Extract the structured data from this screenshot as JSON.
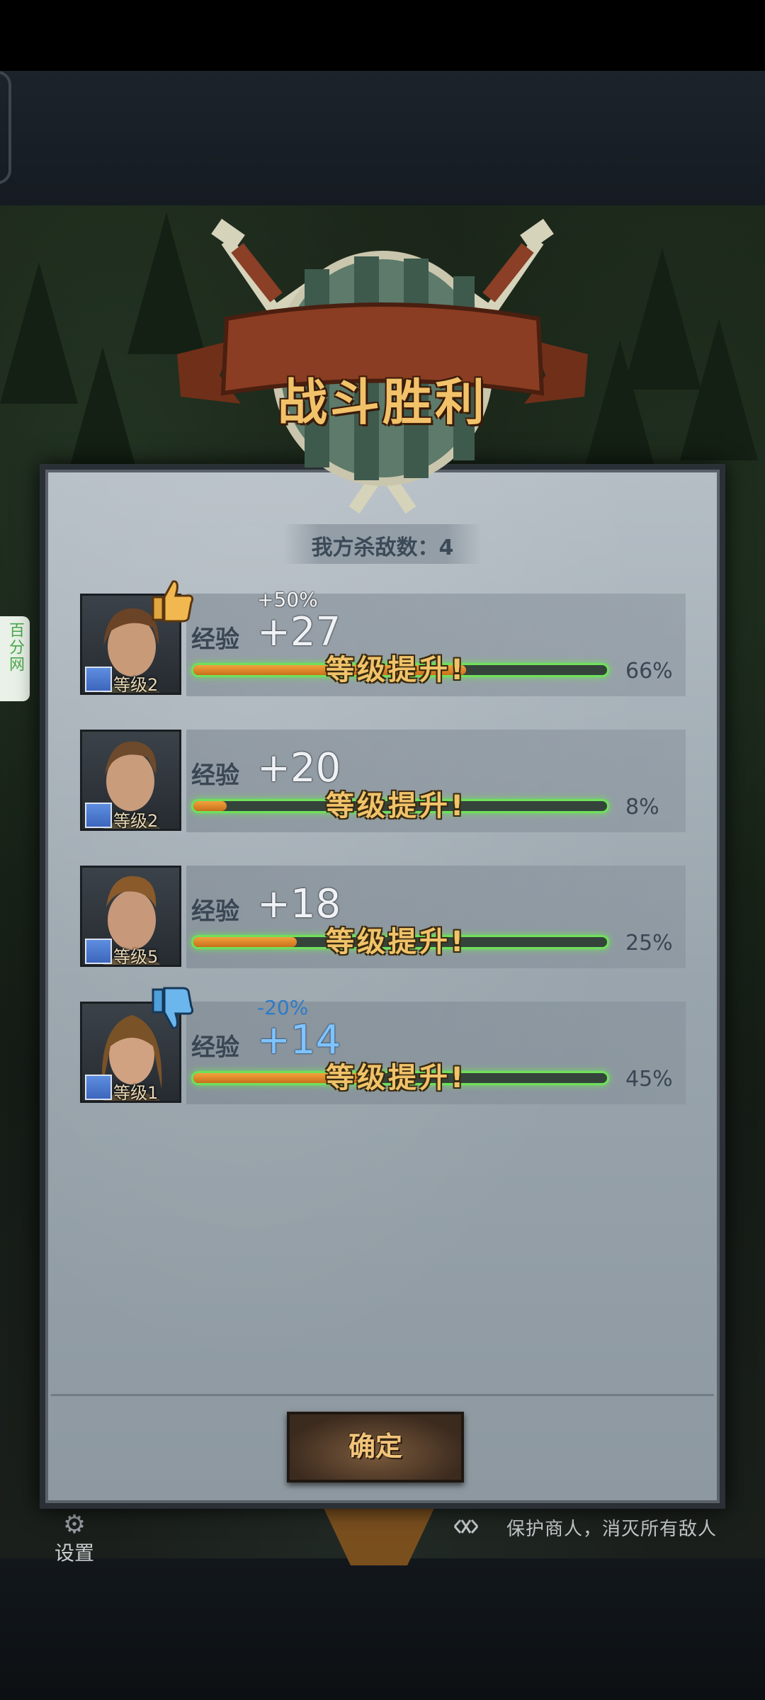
{
  "title": "战斗胜利",
  "kills": "我方杀敌数：4",
  "side_badge": "百分网",
  "heroes": [
    {
      "exp_label": "经验",
      "exp_gain": "+27",
      "bonus": "+50%",
      "bonus_kind": "positive",
      "level": "等级2",
      "level_up": "等级提升!",
      "progress_pct": 66,
      "progress_text": "66%",
      "thumb": "thumbs-up"
    },
    {
      "exp_label": "经验",
      "exp_gain": "+20",
      "bonus": "",
      "bonus_kind": "none",
      "level": "等级2",
      "level_up": "等级提升!",
      "progress_pct": 8,
      "progress_text": "8%",
      "thumb": "none"
    },
    {
      "exp_label": "经验",
      "exp_gain": "+18",
      "bonus": "",
      "bonus_kind": "none",
      "level": "等级5",
      "level_up": "等级提升!",
      "progress_pct": 25,
      "progress_text": "25%",
      "thumb": "none"
    },
    {
      "exp_label": "经验",
      "exp_gain": "+14",
      "bonus": "-20%",
      "bonus_kind": "negative",
      "level": "等级1",
      "level_up": "等级提升!",
      "progress_pct": 45,
      "progress_text": "45%",
      "thumb": "thumbs-down"
    }
  ],
  "confirm_label": "确定",
  "bottom_hud": {
    "settings_label": "设置",
    "mission_text": "保护商人，消灭所有敌人"
  },
  "colors": {
    "bar_glow": "#6fe05b",
    "bar_fill": "#e08a2c",
    "level_up_text": "#f0c36a",
    "banner": "#8a3d22"
  }
}
